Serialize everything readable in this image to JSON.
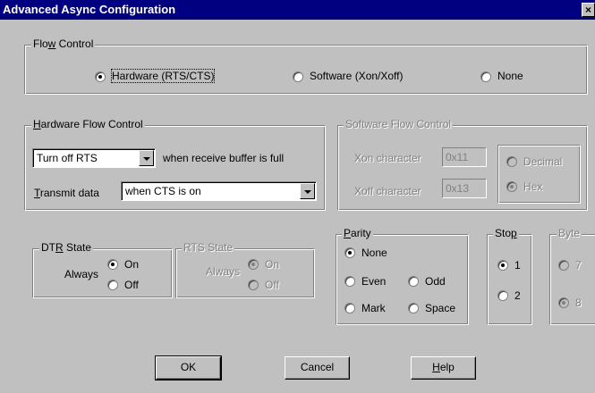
{
  "window": {
    "title": "Advanced Async Configuration",
    "close_glyph": "×"
  },
  "flow_control": {
    "legend_pre": "Flo",
    "legend_acc": "w",
    "legend_post": " Control",
    "options": [
      {
        "label": "Hardware (RTS/CTS)",
        "selected": true
      },
      {
        "label": "Software (Xon/Xoff)",
        "selected": false
      },
      {
        "label": "None",
        "selected": false
      }
    ]
  },
  "hardware_flow": {
    "legend_acc": "H",
    "legend_post": "ardware Flow Control",
    "rts_value": "Turn off RTS",
    "rts_suffix": "when receive buffer is full",
    "transmit_acc": "T",
    "transmit_post": "ransmit data",
    "transmit_value": "when CTS is on"
  },
  "software_flow": {
    "legend": "Software Flow Control",
    "xon_label": "Xon character",
    "xon_value": "0x11",
    "xoff_label": "Xoff character",
    "xoff_value": "0x13",
    "decimal_label": "Decimal",
    "hex_label": "Hex"
  },
  "dtr_state": {
    "legend_pre": "DT",
    "legend_acc": "R",
    "legend_post": " State",
    "mode": "Always",
    "on": "On",
    "off": "Off"
  },
  "rts_state": {
    "legend": "RTS State",
    "mode": "Always",
    "on": "On",
    "off": "Off"
  },
  "parity": {
    "legend_acc": "P",
    "legend_post": "arity",
    "none": "None",
    "even": "Even",
    "odd": "Odd",
    "mark": "Mark",
    "space": "Space"
  },
  "stop": {
    "legend_pre": "Sto",
    "legend_acc": "p",
    "legend_post": "",
    "one": "1",
    "two": "2"
  },
  "byte": {
    "legend": "Byte",
    "seven": "7",
    "eight": "8"
  },
  "buttons": {
    "ok": "OK",
    "cancel": "Cancel",
    "help_acc": "H",
    "help_post": "elp"
  }
}
